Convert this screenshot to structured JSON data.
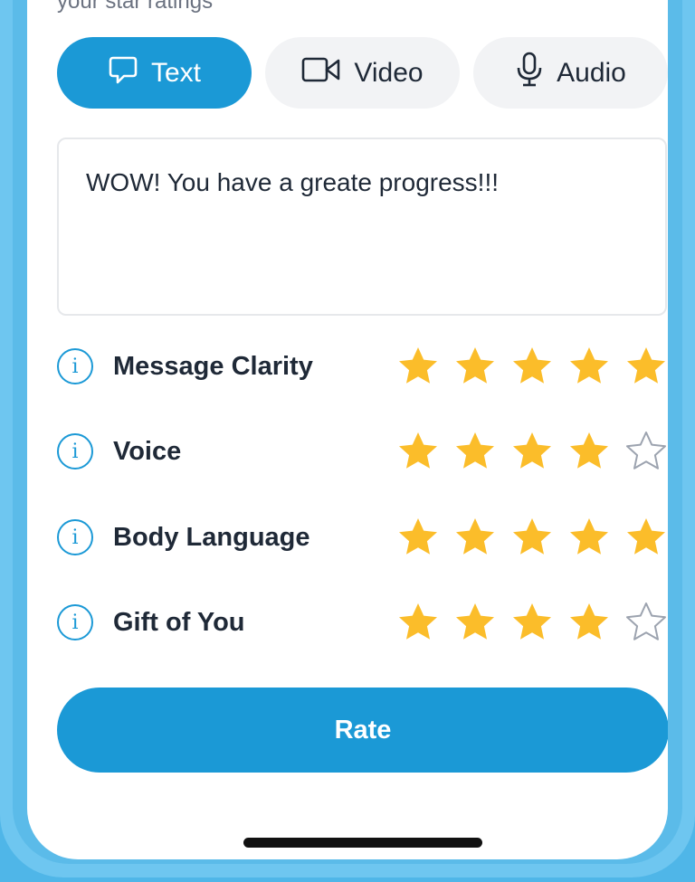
{
  "header": {
    "partial_text": "your star ratings"
  },
  "tabs": [
    {
      "label": "Text",
      "icon": "comment-icon",
      "active": true
    },
    {
      "label": "Video",
      "icon": "video-camera-icon",
      "active": false
    },
    {
      "label": "Audio",
      "icon": "microphone-icon",
      "active": false
    }
  ],
  "comment": {
    "value": "WOW! You have a greate progress!!!"
  },
  "ratings": [
    {
      "label": "Message Clarity",
      "stars": 5,
      "max": 5
    },
    {
      "label": "Voice",
      "stars": 4,
      "max": 5
    },
    {
      "label": "Body Language",
      "stars": 5,
      "max": 5
    },
    {
      "label": "Gift of You",
      "stars": 4,
      "max": 5
    }
  ],
  "rate_button": {
    "label": "Rate"
  },
  "colors": {
    "accent": "#1b99d6",
    "star_filled": "#fbbd2a",
    "star_empty": "#9ca3af",
    "frame": "#5bbbe9"
  }
}
